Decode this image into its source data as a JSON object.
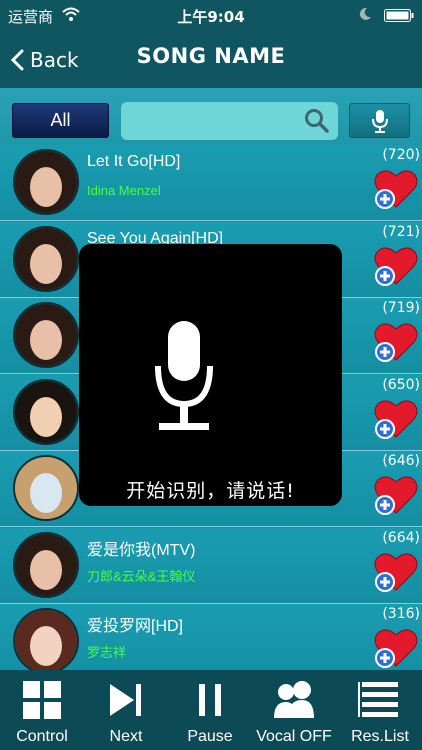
{
  "status_bar": {
    "carrier": "运营商",
    "time": "上午9:04"
  },
  "nav": {
    "back_label": "Back",
    "title": "SONG NAME"
  },
  "search": {
    "all_label": "All",
    "placeholder": ""
  },
  "songs": [
    {
      "title": "Let It Go[HD]",
      "artist": "Idina Menzel",
      "count": "(720)"
    },
    {
      "title": "See You Again[HD]",
      "artist": "",
      "count": "(721)"
    },
    {
      "title": "",
      "artist": "",
      "count": "(719)"
    },
    {
      "title": "",
      "artist": "",
      "count": "(650)"
    },
    {
      "title": "",
      "artist": "",
      "count": "(646)"
    },
    {
      "title": "爱是你我(MTV)",
      "artist": "刀郎&云朵&王翰仪",
      "count": "(664)"
    },
    {
      "title": "爱投罗网[HD]",
      "artist": "罗志祥",
      "count": "(316)"
    }
  ],
  "voice_overlay": {
    "prompt": "开始识别，请说话!"
  },
  "toolbar": {
    "control_label": "Control",
    "next_label": "Next",
    "pause_label": "Pause",
    "vocal_label": "Vocal OFF",
    "reslist_label": "Res.List"
  },
  "colors": {
    "bar_dark": "#0f5660",
    "list_bg": "#1a9db1",
    "artist_green": "#44ff44",
    "heart_red": "#e3192c",
    "plus_blue": "#2f6fd4"
  }
}
